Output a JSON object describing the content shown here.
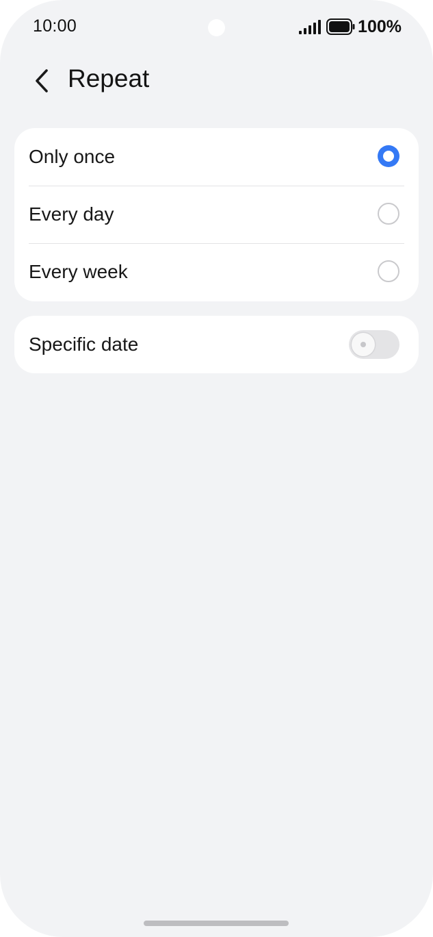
{
  "status_bar": {
    "time": "10:00",
    "battery": "100%",
    "icons": [
      "signal-icon",
      "battery-icon"
    ]
  },
  "header": {
    "back_icon": "chevron-left-icon",
    "title": "Repeat"
  },
  "repeat_options": [
    {
      "label": "Only once",
      "selected": true
    },
    {
      "label": "Every day",
      "selected": false
    },
    {
      "label": "Every week",
      "selected": false
    }
  ],
  "specific_date": {
    "label": "Specific date",
    "enabled": false
  },
  "colors": {
    "background": "#f2f3f5",
    "card": "#ffffff",
    "accent": "#3479f5",
    "toggle_off": "#e4e4e6"
  }
}
